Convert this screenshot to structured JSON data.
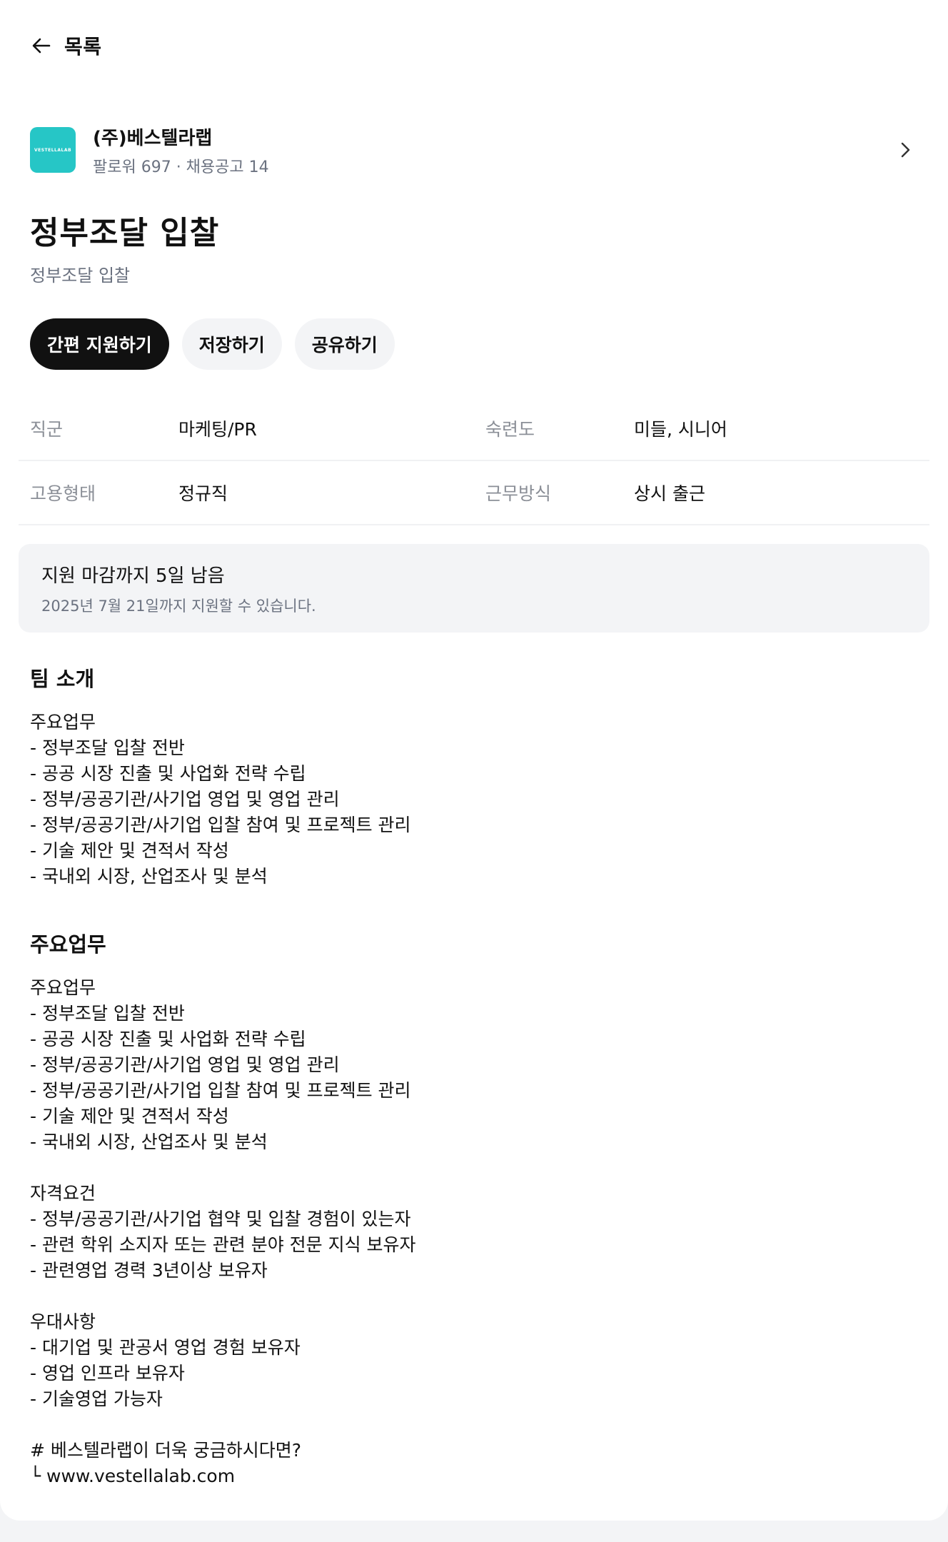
{
  "nav": {
    "back_label": "목록"
  },
  "company": {
    "name": "(주)베스텔라랩",
    "meta": "팔로워 697 · 채용공고 14",
    "logo_text": "VESTELLALAB",
    "logo_color": "#26c6c6"
  },
  "job": {
    "title": "정부조달 입찰",
    "subtitle": "정부조달 입찰"
  },
  "actions": {
    "apply_label": "간편 지원하기",
    "save_label": "저장하기",
    "share_label": "공유하기"
  },
  "info": {
    "job_group_label": "직군",
    "job_group_value": "마케팅/PR",
    "level_label": "숙련도",
    "level_value": "미들, 시니어",
    "employment_label": "고용형태",
    "employment_value": "정규직",
    "work_mode_label": "근무방식",
    "work_mode_value": "상시 출근"
  },
  "deadline": {
    "title": "지원 마감까지 5일 남음",
    "subtitle": "2025년 7월 21일까지 지원할 수 있습니다."
  },
  "sections": {
    "team": {
      "title": "팀 소개",
      "body": "주요업무\n- 정부조달 입찰 전반\n- 공공 시장 진출 및 사업화 전략 수립\n- 정부/공공기관/사기업 영업 및 영업 관리\n- 정부/공공기관/사기업 입찰 참여 및 프로젝트 관리\n- 기술 제안 및 견적서 작성\n- 국내외 시장, 산업조사 및 분석"
    },
    "duties": {
      "title": "주요업무",
      "body": "주요업무\n- 정부조달 입찰 전반\n- 공공 시장 진출 및 사업화 전략 수립\n- 정부/공공기관/사기업 영업 및 영업 관리\n- 정부/공공기관/사기업 입찰 참여 및 프로젝트 관리\n- 기술 제안 및 견적서 작성\n- 국내외 시장, 산업조사 및 분석\n\n자격요건\n- 정부/공공기관/사기업 협약 및 입찰 경험이 있는자\n- 관련 학위 소지자 또는 관련 분야 전문 지식 보유자\n- 관련영업 경력 3년이상 보유자\n\n우대사항\n- 대기업 및 관공서 영업 경험 보유자\n- 영업 인프라 보유자\n- 기술영업 가능자\n\n# 베스텔라랩이 더욱 궁금하시다면?\n└ www.vestellalab.com"
    }
  },
  "colors": {
    "primary_button": "#111111",
    "secondary_button": "#f3f4f6",
    "muted_text": "#6b7280",
    "page_background": "#f3f4f6"
  }
}
